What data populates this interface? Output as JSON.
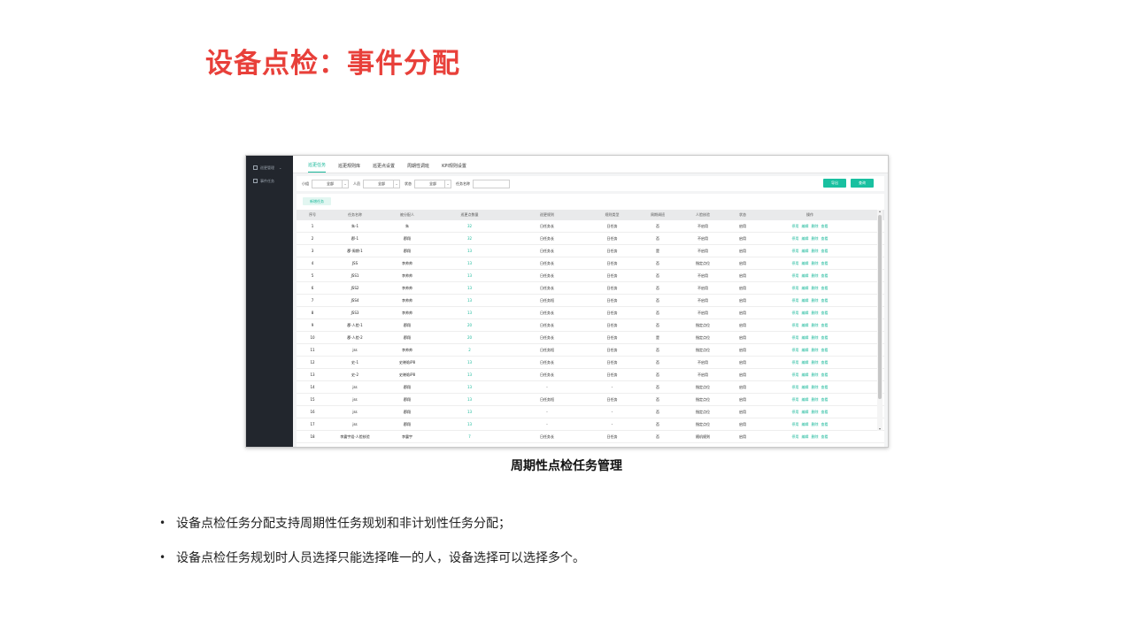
{
  "slide": {
    "title": "设备点检：事件分配",
    "caption": "周期性点检任务管理",
    "bullets": [
      "设备点检任务分配支持周期性任务规划和非计划性任务分配；",
      "设备点检任务规划时人员选择只能选择唯一的人，设备选择可以选择多个。"
    ]
  },
  "app": {
    "sidebar": [
      {
        "label": "巡更管理",
        "icon": "menu-icon"
      },
      {
        "label": "事件任务",
        "icon": "list-icon"
      }
    ],
    "tabs": [
      "巡更任务",
      "巡更规则库",
      "巡更点设置",
      "周期性调班",
      "KPI规则设置"
    ],
    "filters": {
      "group_label": "小组",
      "group_value": "全部",
      "person_label": "人员",
      "person_value": "全部",
      "status_label": "状态",
      "status_value": "全部",
      "task_name_label": "任务名称",
      "task_name_value": "",
      "export_label": "导出",
      "query_label": "查询"
    },
    "new_task_label": "新增任务",
    "columns": [
      "序号",
      "任务名称",
      "被分配人",
      "巡更点数量",
      "巡更规则",
      "规则类型",
      "周期调班",
      "人脸核验",
      "状态",
      "操作"
    ],
    "actions": [
      "停用",
      "编辑",
      "删除",
      "查看"
    ],
    "rows": [
      [
        "1",
        "朱-1",
        "朱",
        "32",
        "日任务长",
        "日任务",
        "否",
        "不启用",
        "启用"
      ],
      [
        "2",
        "郡-1",
        "郡翔",
        "32",
        "日任务长",
        "日任务",
        "否",
        "不启用",
        "启用"
      ],
      [
        "3",
        "郡-周期-1",
        "郡翔",
        "13",
        "日任务长",
        "日任务",
        "是",
        "不启用",
        "启用"
      ],
      [
        "4",
        "JSS",
        "李帅帅",
        "13",
        "日任务长",
        "日任务",
        "否",
        "指定点位",
        "启用"
      ],
      [
        "5",
        "JSS1",
        "李帅帅",
        "13",
        "日任务长",
        "日任务",
        "否",
        "不启用",
        "启用"
      ],
      [
        "6",
        "JSS2",
        "李帅帅",
        "13",
        "日任务长",
        "日任务",
        "否",
        "不启用",
        "启用"
      ],
      [
        "7",
        "JSS4",
        "李帅帅",
        "13",
        "日任务短",
        "日任务",
        "否",
        "不启用",
        "启用"
      ],
      [
        "8",
        "JSS3",
        "李帅帅",
        "13",
        "日任务长",
        "日任务",
        "否",
        "不启用",
        "启用"
      ],
      [
        "9",
        "郡-人脸-1",
        "郡翔",
        "20",
        "日任务长",
        "日任务",
        "否",
        "指定点位",
        "启用"
      ],
      [
        "10",
        "郡-人脸-2",
        "郡翔",
        "20",
        "日任务长",
        "日任务",
        "是",
        "指定点位",
        "启用"
      ],
      [
        "11",
        "jss",
        "李帅帅",
        "2",
        "日任务短",
        "日任务",
        "否",
        "指定点位",
        "启用"
      ],
      [
        "12",
        "史-1",
        "史晓晗iP8",
        "13",
        "日任务长",
        "日任务",
        "否",
        "不启用",
        "启用"
      ],
      [
        "13",
        "史-2",
        "史晓晗iP8",
        "13",
        "日任务长",
        "日任务",
        "否",
        "不启用",
        "启用"
      ],
      [
        "14",
        "jss",
        "郡翔",
        "13",
        "-",
        "-",
        "否",
        "指定点位",
        "启用"
      ],
      [
        "15",
        "jss",
        "郡翔",
        "13",
        "日任务短",
        "日任务",
        "否",
        "指定点位",
        "启用"
      ],
      [
        "16",
        "jss",
        "郡翔",
        "13",
        "-",
        "-",
        "否",
        "指定点位",
        "启用"
      ],
      [
        "17",
        "jss",
        "郡翔",
        "13",
        "-",
        "-",
        "否",
        "指定点位",
        "启用"
      ],
      [
        "18",
        "李震宇组-人脸核验",
        "李震宇",
        "7",
        "日任务长",
        "日任务",
        "否",
        "随机规则",
        "启用"
      ]
    ]
  },
  "colors": {
    "title": "#e8403a",
    "accent": "#19b89a",
    "sidebar": "#22262d"
  }
}
